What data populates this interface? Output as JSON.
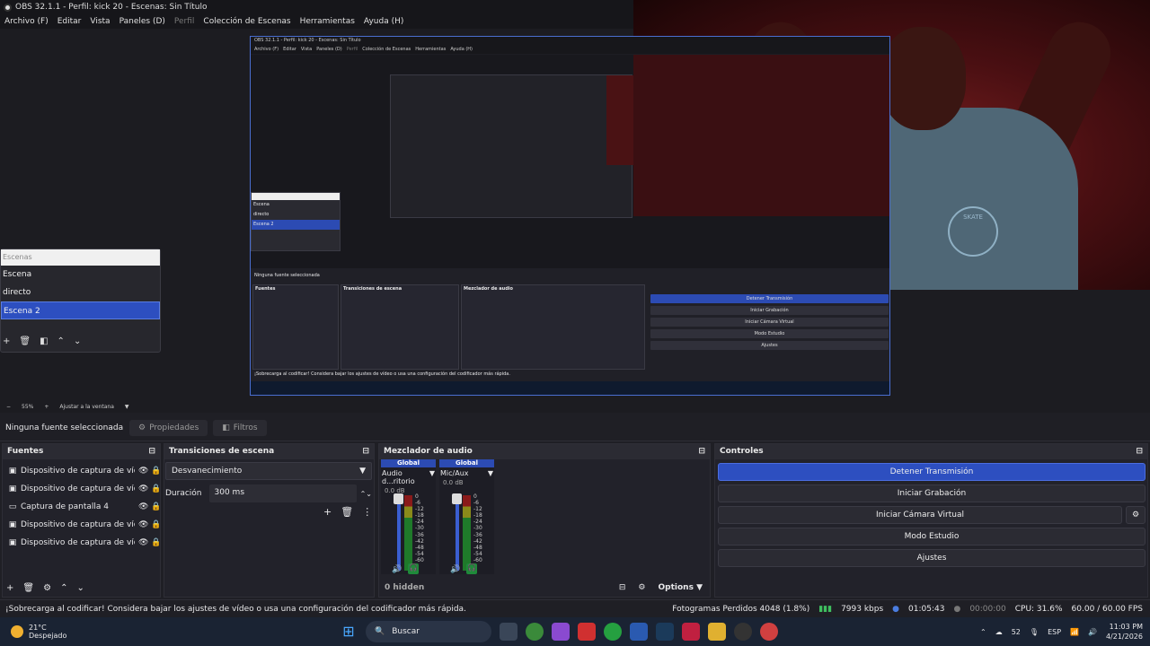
{
  "window": {
    "title": "OBS 32.1.1 - Perfil: kick 20 - Escenas: Sin Título"
  },
  "menu": [
    "Archivo (F)",
    "Editar",
    "Vista",
    "Paneles (D)",
    "Perfil",
    "Colección de Escenas",
    "Herramientas",
    "Ayuda (H)"
  ],
  "inner": {
    "title": "OBS 32.1.1 - Perfil: kick 20 - Escenas: Sin Título",
    "menu": [
      "Archivo (F)",
      "Editar",
      "Vista",
      "Paneles (D)",
      "Perfil",
      "Colección de Escenas",
      "Herramientas",
      "Ayuda (H)"
    ],
    "scenes": [
      "Escena",
      "directo",
      "Escena 2"
    ],
    "no_source": "Ninguna fuente seleccionada",
    "sources_header": "Fuentes",
    "transitions_header": "Transiciones de escena",
    "mixer_header": "Mezclador de audio",
    "buttons": [
      "Detener Transmisión",
      "Iniciar Grabación",
      "Iniciar Cámara Virtual",
      "Modo Estudio",
      "Ajustes"
    ],
    "status": "¡Sobrecarga al codificar! Considera bajar los ajustes de vídeo o usa una configuración del codificador más rápida."
  },
  "scenes": {
    "header": "Escenas",
    "items": [
      "Escena",
      "directo",
      "Escena 2"
    ],
    "selected": 2
  },
  "zoom": {
    "value": "55%",
    "fit": "Ajustar a la ventana"
  },
  "context": {
    "no_source": "Ninguna fuente seleccionada",
    "properties": "Propiedades",
    "filters": "Filtros"
  },
  "sources": {
    "header": "Fuentes",
    "items": [
      "Dispositivo de captura de vídeo",
      "Dispositivo de captura de vídeo",
      "Captura de pantalla 4",
      "Dispositivo de captura de vídeo",
      "Dispositivo de captura de vídeo"
    ]
  },
  "transitions": {
    "header": "Transiciones de escena",
    "selected": "Desvanecimiento",
    "duration_label": "Duración",
    "duration_value": "300 ms"
  },
  "mixer": {
    "header": "Mezclador de audio",
    "channels": [
      {
        "global": "Global",
        "name": "Audio d...ritorio",
        "db": "0.0 dB"
      },
      {
        "global": "Global",
        "name": "Mic/Aux",
        "db": "0.0 dB"
      }
    ],
    "scale": [
      "0",
      "-6",
      "-12",
      "-18",
      "-24",
      "-30",
      "-36",
      "-42",
      "-48",
      "-54",
      "-60"
    ],
    "hidden": "0 hidden",
    "options": "Options"
  },
  "controls": {
    "header": "Controles",
    "buttons": [
      "Detener Transmisión",
      "Iniciar Grabación",
      "Iniciar Cámara Virtual",
      "Modo Estudio",
      "Ajustes"
    ]
  },
  "status": {
    "message": "¡Sobrecarga al codificar! Considera bajar los ajustes de vídeo o usa una configuración del codificador más rápida.",
    "dropped": "Fotogramas Perdidos 4048 (1.8%)",
    "bitrate": "7993 kbps",
    "stream_time": "01:05:43",
    "rec_time": "00:00:00",
    "cpu": "CPU: 31.6%",
    "fps": "60.00 / 60.00 FPS"
  },
  "taskbar": {
    "temp": "21°C",
    "weather": "Despejado",
    "search": "Buscar",
    "lang": "ESP",
    "time": "11:03 PM",
    "date": "4/21/2026",
    "badge": "52"
  },
  "webcam": {
    "shirt_text": "SKATE"
  }
}
